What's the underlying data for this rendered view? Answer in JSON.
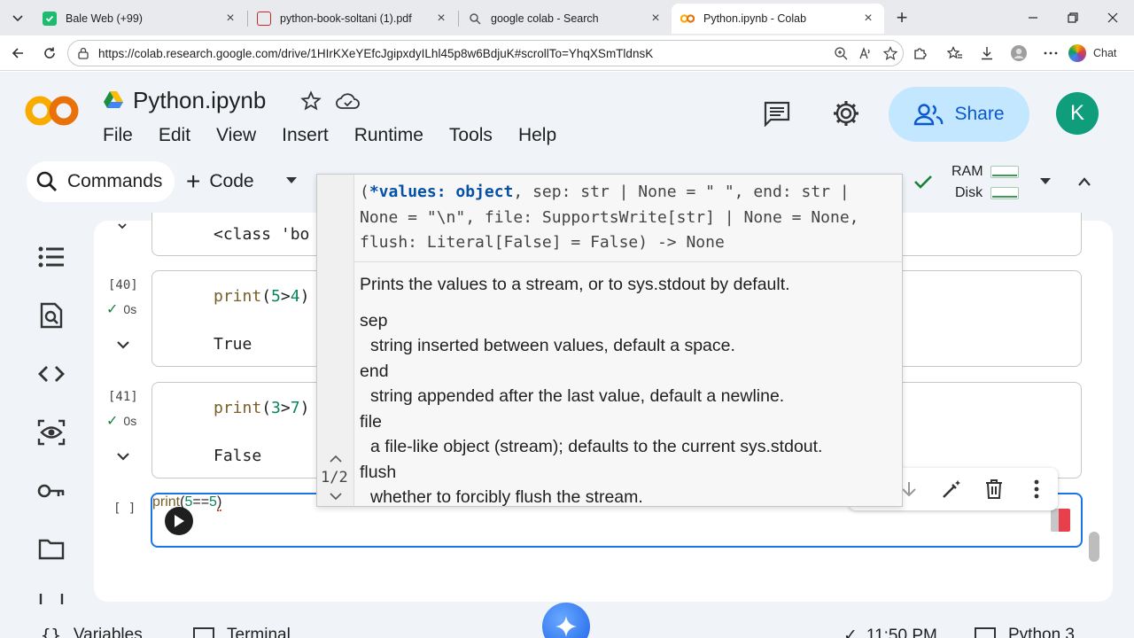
{
  "browser": {
    "tabs": [
      {
        "title": "Bale Web (+99)",
        "icon": "bale-icon",
        "active": false
      },
      {
        "title": "python-book-soltani (1).pdf",
        "icon": "pdf-icon",
        "active": false
      },
      {
        "title": "google colab - Search",
        "icon": "search-icon",
        "active": false
      },
      {
        "title": "Python.ipynb - Colab",
        "icon": "colab-icon",
        "active": true
      }
    ],
    "url": "https://colab.research.google.com/drive/1HIrKXeYEfcJgipxdyILhl45p8w6BdjuK#scrollTo=YhqXSmTldnsK",
    "chat_label": "Chat"
  },
  "colab": {
    "notebook_title": "Python.ipynb",
    "menu": [
      "File",
      "Edit",
      "View",
      "Insert",
      "Runtime",
      "Tools",
      "Help"
    ],
    "share_label": "Share",
    "avatar_initial": "K",
    "commands_label": "Commands",
    "code_label": "Code",
    "ram_label": "RAM",
    "disk_label": "Disk"
  },
  "cells": {
    "partial_output": "<class 'bo",
    "cell40": {
      "count": "[40]",
      "status": "0s",
      "code": "print(5>4)",
      "output": "True"
    },
    "cell41": {
      "count": "[41]",
      "status": "0s",
      "code": "print(3>7)",
      "output": "False"
    },
    "active": {
      "count": "[ ]",
      "code": "print(5==5)"
    }
  },
  "tooltip": {
    "signature_lines": [
      "(*values: object, sep: str | None = \" \", end: str |",
      "None = \"\\n\", file: SupportsWrite[str] | None = None,",
      "flush: Literal[False] = False) -> None"
    ],
    "signature_highlight": "*values: object",
    "description": "Prints the values to a stream, or to sys.stdout by default.",
    "params": [
      {
        "name": "sep",
        "desc": "string inserted between values, default a space."
      },
      {
        "name": "end",
        "desc": "string appended after the last value, default a newline."
      },
      {
        "name": "file",
        "desc": "a file-like object (stream); defaults to the current sys.stdout."
      },
      {
        "name": "flush",
        "desc": "whether to forcibly flush the stream."
      }
    ],
    "counter": "1/2"
  },
  "statusbar": {
    "variables_label": "Variables",
    "terminal_label": "Terminal",
    "time": "11:50 PM",
    "runtime_label": "Python 3"
  },
  "colors": {
    "accent_blue": "#1a73e8",
    "share_bg": "#c2e7ff",
    "avatar_bg": "#0f9d7c",
    "ok_green": "#188038"
  }
}
